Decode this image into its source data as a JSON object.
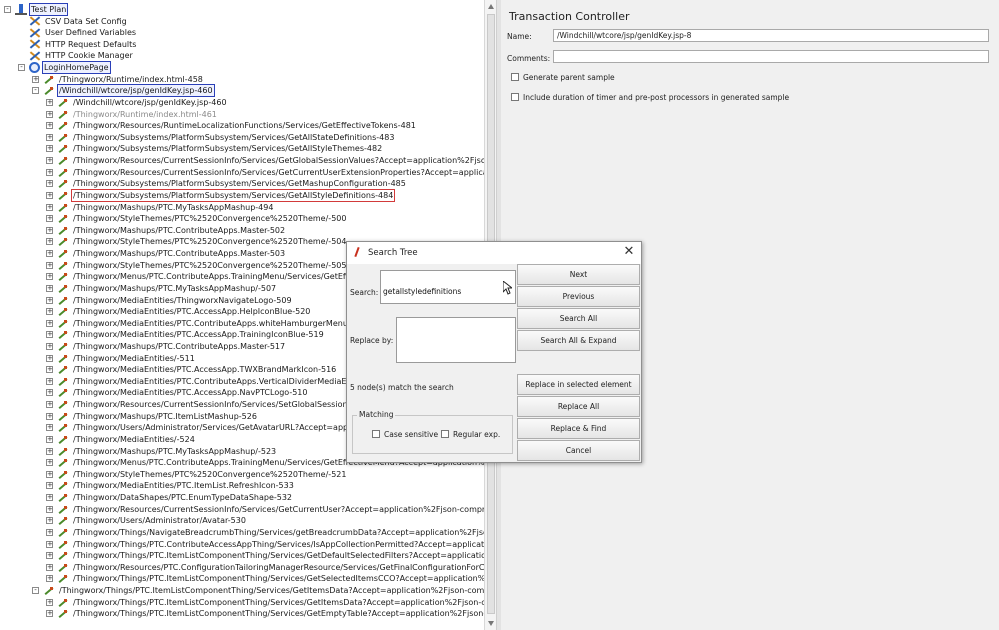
{
  "tree": {
    "items": [
      {
        "label": "Test Plan",
        "icon": "test-plan-icon",
        "indent": 0,
        "expander": "-",
        "style": "blue"
      },
      {
        "label": "CSV Data Set Config",
        "icon": "config-element-icon",
        "indent": 1,
        "expander": ""
      },
      {
        "label": "User Defined Variables",
        "icon": "config-element-icon",
        "indent": 1,
        "expander": ""
      },
      {
        "label": "HTTP Request Defaults",
        "icon": "config-element-icon",
        "indent": 1,
        "expander": ""
      },
      {
        "label": "HTTP Cookie Manager",
        "icon": "config-element-icon",
        "indent": 1,
        "expander": ""
      },
      {
        "label": "LoginHomePage",
        "icon": "controller-icon",
        "indent": 1,
        "expander": "-",
        "style": "blue"
      },
      {
        "label": "/Thingworx/Runtime/index.html-458",
        "icon": "sampler-icon",
        "indent": 2,
        "expander": "+"
      },
      {
        "label": "/Windchill/wtcore/jsp/genIdKey.jsp-460",
        "icon": "sampler-icon",
        "indent": 2,
        "expander": "-",
        "style": "blue"
      },
      {
        "label": "/Windchill/wtcore/jsp/genIdKey.jsp-460",
        "icon": "sampler-icon",
        "indent": 3,
        "expander": "+"
      },
      {
        "label": "/Thingworx/Runtime/index.html-461",
        "icon": "sampler-icon",
        "indent": 3,
        "expander": "+",
        "style": "dim"
      },
      {
        "label": "/Thingworx/Resources/RuntimeLocalizationFunctions/Services/GetEffectiveTokens-481",
        "icon": "sampler-icon",
        "indent": 3,
        "expander": "+"
      },
      {
        "label": "/Thingworx/Subsystems/PlatformSubsystem/Services/GetAllStateDefinitions-483",
        "icon": "sampler-icon",
        "indent": 3,
        "expander": "+"
      },
      {
        "label": "/Thingworx/Subsystems/PlatformSubsystem/Services/GetAllStyleThemes-482",
        "icon": "sampler-icon",
        "indent": 3,
        "expander": "+"
      },
      {
        "label": "/Thingworx/Resources/CurrentSessionInfo/Services/GetGlobalSessionValues?Accept=application%2Fjson-compressed",
        "icon": "sampler-icon",
        "indent": 3,
        "expander": "+"
      },
      {
        "label": "/Thingworx/Resources/CurrentSessionInfo/Services/GetCurrentUserExtensionProperties?Accept=application%2Fjson",
        "icon": "sampler-icon",
        "indent": 3,
        "expander": "+"
      },
      {
        "label": "/Thingworx/Subsystems/PlatformSubsystem/Services/GetMashupConfiguration-485",
        "icon": "sampler-icon",
        "indent": 3,
        "expander": "+"
      },
      {
        "label": "/Thingworx/Subsystems/PlatformSubsystem/Services/GetAllStyleDefinitions-484",
        "icon": "sampler-icon",
        "indent": 3,
        "expander": "+",
        "style": "red"
      },
      {
        "label": "/Thingworx/Mashups/PTC.MyTasksAppMashup-494",
        "icon": "sampler-icon",
        "indent": 3,
        "expander": "+"
      },
      {
        "label": "/Thingworx/StyleThemes/PTC%2520Convergence%2520Theme/-500",
        "icon": "sampler-icon",
        "indent": 3,
        "expander": "+"
      },
      {
        "label": "/Thingworx/Mashups/PTC.ContributeApps.Master-502",
        "icon": "sampler-icon",
        "indent": 3,
        "expander": "+"
      },
      {
        "label": "/Thingworx/StyleThemes/PTC%2520Convergence%2520Theme/-504",
        "icon": "sampler-icon",
        "indent": 3,
        "expander": "+"
      },
      {
        "label": "/Thingworx/Mashups/PTC.ContributeApps.Master-503",
        "icon": "sampler-icon",
        "indent": 3,
        "expander": "+"
      },
      {
        "label": "/Thingworx/StyleThemes/PTC%2520Convergence%2520Theme/-505",
        "icon": "sampler-icon",
        "indent": 3,
        "expander": "+"
      },
      {
        "label": "/Thingworx/Menus/PTC.ContributeApps.TrainingMenu/Services/GetEffectiveM",
        "icon": "sampler-icon",
        "indent": 3,
        "expander": "+"
      },
      {
        "label": "/Thingworx/Mashups/PTC.MyTasksAppMashup/-507",
        "icon": "sampler-icon",
        "indent": 3,
        "expander": "+"
      },
      {
        "label": "/Thingworx/MediaEntities/ThingworxNavigateLogo-509",
        "icon": "sampler-icon",
        "indent": 3,
        "expander": "+"
      },
      {
        "label": "/Thingworx/MediaEntities/PTC.AccessApp.HelpIconBlue-520",
        "icon": "sampler-icon",
        "indent": 3,
        "expander": "+"
      },
      {
        "label": "/Thingworx/MediaEntities/PTC.ContributeApps.whiteHamburgerMenu-518",
        "icon": "sampler-icon",
        "indent": 3,
        "expander": "+"
      },
      {
        "label": "/Thingworx/MediaEntities/PTC.AccessApp.TrainingIconBlue-519",
        "icon": "sampler-icon",
        "indent": 3,
        "expander": "+"
      },
      {
        "label": "/Thingworx/Mashups/PTC.ContributeApps.Master-517",
        "icon": "sampler-icon",
        "indent": 3,
        "expander": "+"
      },
      {
        "label": "/Thingworx/MediaEntities/-511",
        "icon": "sampler-icon",
        "indent": 3,
        "expander": "+"
      },
      {
        "label": "/Thingworx/MediaEntities/PTC.AccessApp.TWXBrandMarkIcon-516",
        "icon": "sampler-icon",
        "indent": 3,
        "expander": "+"
      },
      {
        "label": "/Thingworx/MediaEntities/PTC.ContributeApps.VerticalDividerMediaEntity-513",
        "icon": "sampler-icon",
        "indent": 3,
        "expander": "+"
      },
      {
        "label": "/Thingworx/MediaEntities/PTC.AccessApp.NavPTCLogo-510",
        "icon": "sampler-icon",
        "indent": 3,
        "expander": "+"
      },
      {
        "label": "/Thingworx/Resources/CurrentSessionInfo/Services/SetGlobalSessionStringVal",
        "icon": "sampler-icon",
        "indent": 3,
        "expander": "+"
      },
      {
        "label": "/Thingworx/Mashups/PTC.ItemListMashup-526",
        "icon": "sampler-icon",
        "indent": 3,
        "expander": "+"
      },
      {
        "label": "/Thingworx/Users/Administrator/Services/GetAvatarURL?Accept=application%",
        "icon": "sampler-icon",
        "indent": 3,
        "expander": "+"
      },
      {
        "label": "/Thingworx/MediaEntities/-524",
        "icon": "sampler-icon",
        "indent": 3,
        "expander": "+"
      },
      {
        "label": "/Thingworx/Mashups/PTC.MyTasksAppMashup/-523",
        "icon": "sampler-icon",
        "indent": 3,
        "expander": "+"
      },
      {
        "label": "/Thingworx/Menus/PTC.ContributeApps.TrainingMenu/Services/GetEffectiveMenu?Accept=application%2Fjson-comp",
        "icon": "sampler-icon",
        "indent": 3,
        "expander": "+"
      },
      {
        "label": "/Thingworx/StyleThemes/PTC%2520Convergence%2520Theme/-521",
        "icon": "sampler-icon",
        "indent": 3,
        "expander": "+"
      },
      {
        "label": "/Thingworx/MediaEntities/PTC.ItemList.RefreshIcon-533",
        "icon": "sampler-icon",
        "indent": 3,
        "expander": "+"
      },
      {
        "label": "/Thingworx/DataShapes/PTC.EnumTypeDataShape-532",
        "icon": "sampler-icon",
        "indent": 3,
        "expander": "+"
      },
      {
        "label": "/Thingworx/Resources/CurrentSessionInfo/Services/GetCurrentUser?Accept=application%2Fjson-compressed&_twsr",
        "icon": "sampler-icon",
        "indent": 3,
        "expander": "+"
      },
      {
        "label": "/Thingworx/Users/Administrator/Avatar-530",
        "icon": "sampler-icon",
        "indent": 3,
        "expander": "+"
      },
      {
        "label": "/Thingworx/Things/NavigateBreadcrumbThing/Services/getBreadcrumbData?Accept=application%2Fjson-compressed",
        "icon": "sampler-icon",
        "indent": 3,
        "expander": "+"
      },
      {
        "label": "/Thingworx/Things/PTC.ContributeAccessAppThing/Services/IsAppCollectionPermitted?Accept=application%2Fjson-c",
        "icon": "sampler-icon",
        "indent": 3,
        "expander": "+"
      },
      {
        "label": "/Thingworx/Things/PTC.ItemListComponentThing/Services/GetDefaultSelectedFilters?Accept=application%2Fjson-co",
        "icon": "sampler-icon",
        "indent": 3,
        "expander": "+"
      },
      {
        "label": "/Thingworx/Resources/PTC.ConfigurationTailoringManagerResource/Services/GetFinalConfigurationForComponent?A",
        "icon": "sampler-icon",
        "indent": 3,
        "expander": "+"
      },
      {
        "label": "/Thingworx/Things/PTC.ItemListComponentThing/Services/GetSelectedItemsCCO?Accept=application%2Fjson-compr",
        "icon": "sampler-icon",
        "indent": 3,
        "expander": "+"
      },
      {
        "label": "/Thingworx/Things/PTC.ItemListComponentThing/Services/GetItemsData?Accept=application%2Fjson-compressed&_twsr",
        "icon": "sampler-icon",
        "indent": 2,
        "expander": "-"
      },
      {
        "label": "/Thingworx/Things/PTC.ItemListComponentThing/Services/GetItemsData?Accept=application%2Fjson-compressed&_tw",
        "icon": "sampler-icon",
        "indent": 3,
        "expander": "+"
      },
      {
        "label": "/Thingworx/Things/PTC.ItemListComponentThing/Services/GetEmptyTable?Accept=application%2Fjson-compressed",
        "icon": "sampler-icon",
        "indent": 3,
        "expander": "+"
      }
    ]
  },
  "right_panel": {
    "title": "Transaction Controller",
    "name_label": "Name:",
    "name_value": "/Windchill/wtcore/jsp/genIdKey.jsp-8",
    "comments_label": "Comments:",
    "comments_value": "",
    "generate_parent_label": "Generate parent sample",
    "include_duration_label": "Include duration of timer and pre-post processors in generated sample"
  },
  "dialog": {
    "title": "Search Tree",
    "search_label": "Search:",
    "search_value": "getallstyledefinitions",
    "replace_label": "Replace by:",
    "replace_value": "",
    "status": "5 node(s) match the search",
    "matching_label": "Matching",
    "case_sensitive_label": "Case sensitive",
    "regex_label": "Regular exp.",
    "buttons": {
      "next": "Next",
      "previous": "Previous",
      "search_all": "Search All",
      "search_all_expand": "Search All & Expand",
      "replace_selected": "Replace in selected element",
      "replace_all": "Replace All",
      "replace_find": "Replace & Find",
      "cancel": "Cancel"
    },
    "close_glyph": "✕"
  },
  "colors": {
    "selection_outline": "#2a3fb8",
    "match_outline": "#d23a3a"
  }
}
